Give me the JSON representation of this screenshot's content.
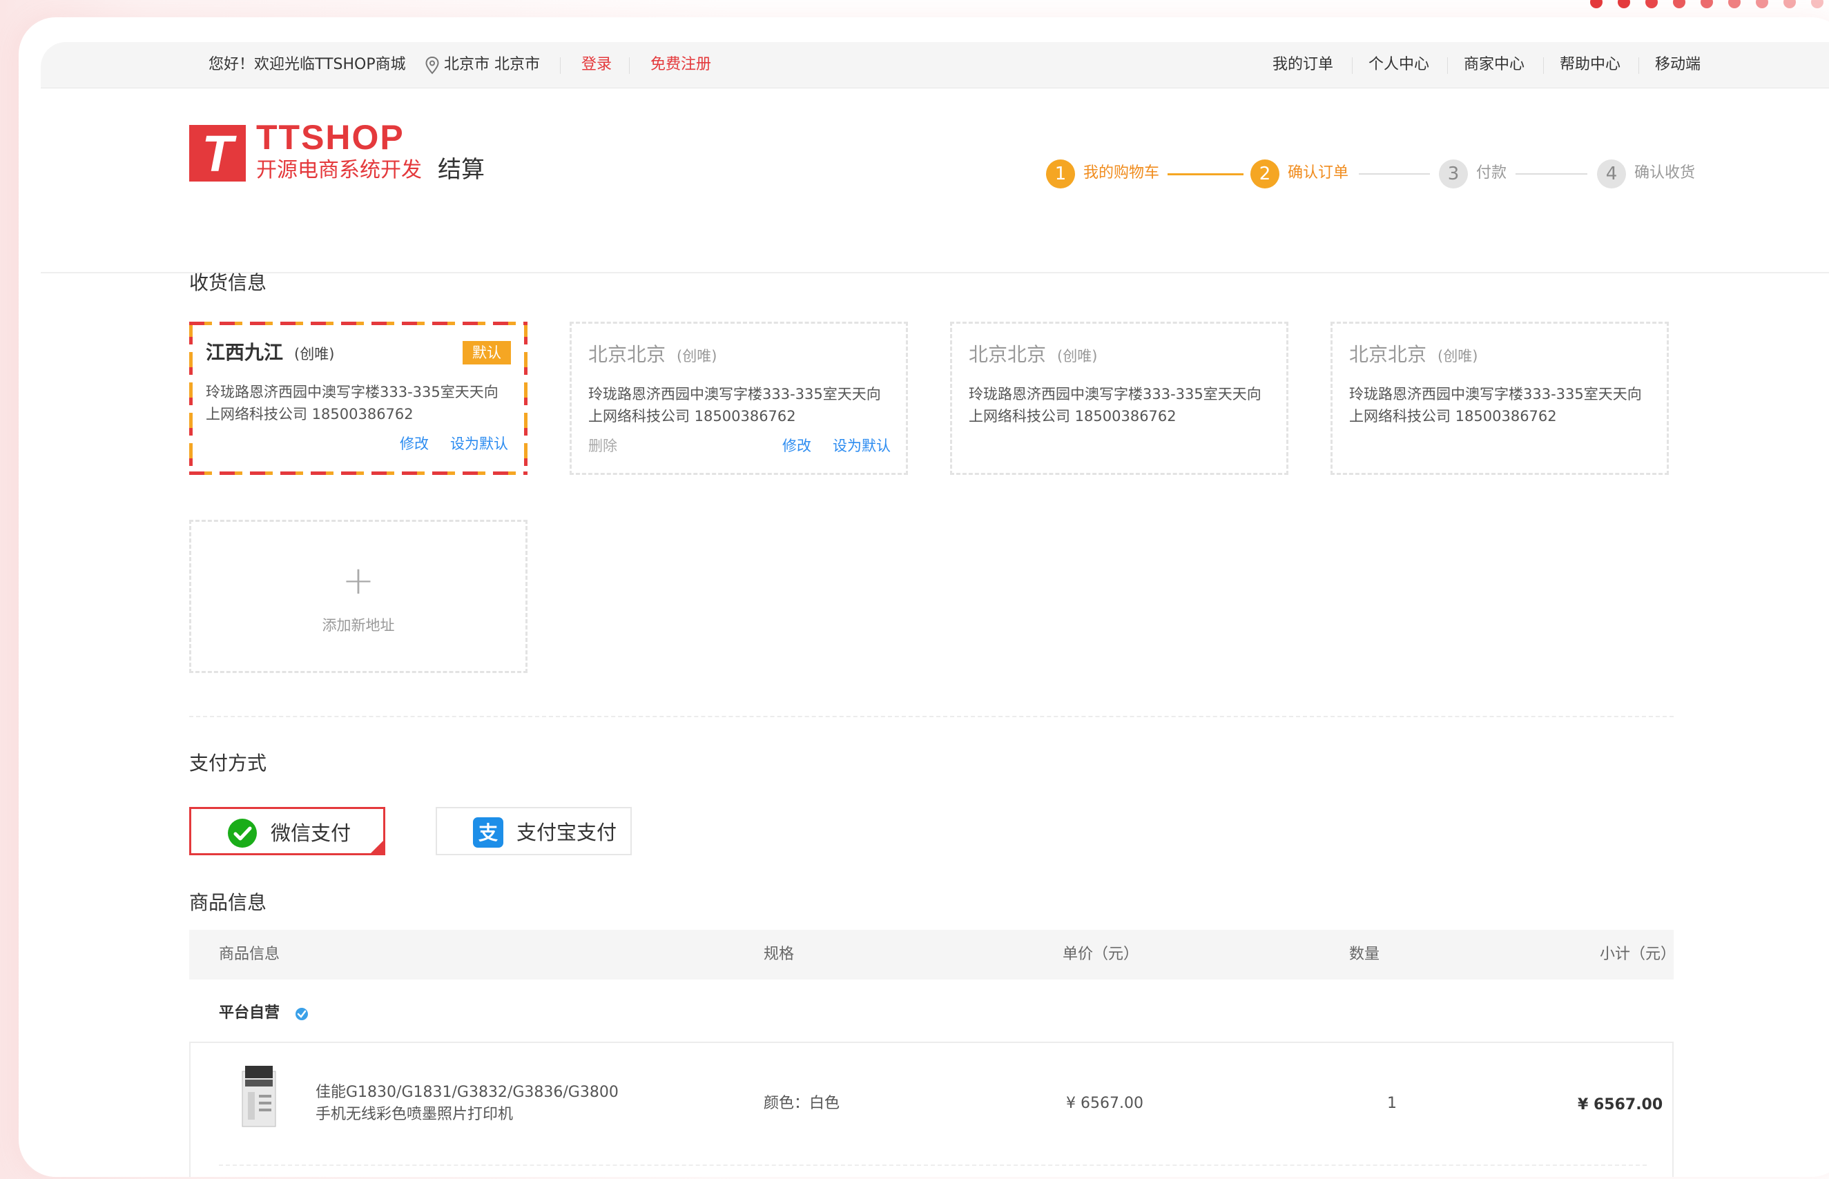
{
  "topbar": {
    "welcome": "您好！欢迎光临TTSHOP商城",
    "location": "北京市 北京市",
    "login": "登录",
    "register": "免费注册",
    "links": [
      "我的订单",
      "个人中心",
      "商家中心",
      "帮助中心",
      "移动端"
    ]
  },
  "logo": {
    "mark": "T",
    "name": "TTSHOP",
    "subtitle": "开源电商系统开发",
    "page": "结算"
  },
  "steps": [
    {
      "num": "1",
      "label": "我的购物车",
      "active": true
    },
    {
      "num": "2",
      "label": "确认订单",
      "active": true
    },
    {
      "num": "3",
      "label": "付款",
      "active": false
    },
    {
      "num": "4",
      "label": "确认收货",
      "active": false
    }
  ],
  "shipping": {
    "title": "收货信息",
    "addresses": [
      {
        "city": "江西九江",
        "name": "(创唯)",
        "detail": "玲珑路恩济西园中澳写字楼333-335室天天向上网络科技公司  18500386762",
        "default_tag": "默认",
        "edit": "修改",
        "set_default": "设为默认"
      },
      {
        "city": "北京北京",
        "name": "(创唯)",
        "detail": "玲珑路恩济西园中澳写字楼333-335室天天向上网络科技公司  18500386762",
        "delete": "删除",
        "edit": "修改",
        "set_default": "设为默认"
      },
      {
        "city": "北京北京",
        "name": "(创唯)",
        "detail": "玲珑路恩济西园中澳写字楼333-335室天天向上网络科技公司  18500386762"
      },
      {
        "city": "北京北京",
        "name": "(创唯)",
        "detail": "玲珑路恩济西园中澳写字楼333-335室天天向上网络科技公司  18500386762"
      }
    ],
    "add_new": "添加新地址"
  },
  "payment": {
    "title": "支付方式",
    "options": [
      {
        "label": "微信支付",
        "icon": "wechat-icon",
        "selected": true
      },
      {
        "label": "支付宝支付",
        "icon": "alipay-icon",
        "selected": false
      }
    ]
  },
  "goods": {
    "title": "商品信息",
    "columns": [
      "商品信息",
      "规格",
      "单价（元）",
      "数量",
      "小计（元）"
    ],
    "store": "平台自营",
    "items": [
      {
        "name_line1": "佳能G1830/G1831/G3832/G3836/G3800",
        "name_line2": "手机无线彩色喷墨照片打印机",
        "spec": "颜色：白色",
        "price": "¥ 6567.00",
        "qty": "1",
        "subtotal": "¥ 6567.00"
      }
    ]
  },
  "colors": {
    "brand": "#e4393c",
    "accent": "#f5a623",
    "link": "#2d8cf0"
  }
}
